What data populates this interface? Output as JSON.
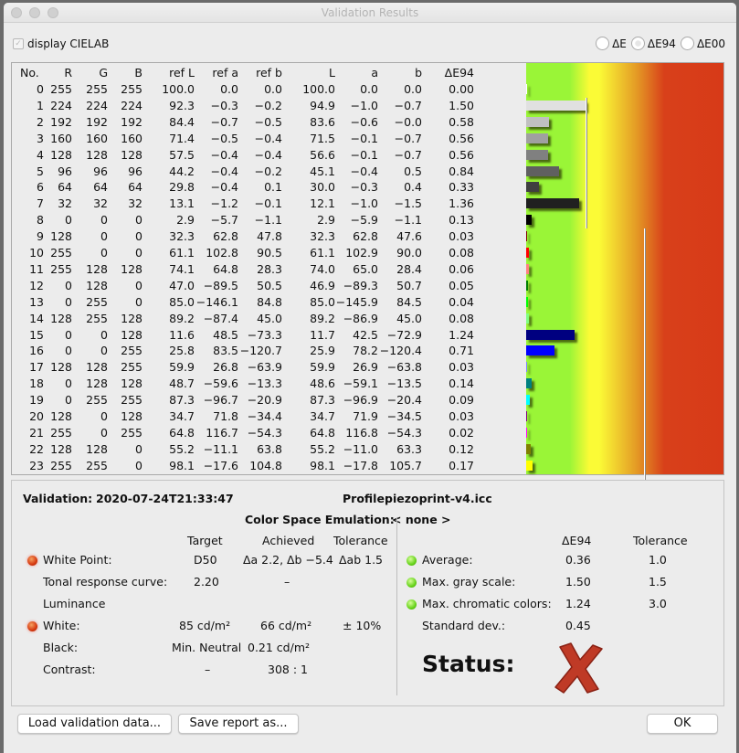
{
  "window": {
    "title": "Validation Results"
  },
  "options": {
    "display_cielab_label": "display CIELAB",
    "display_cielab_checked": true,
    "metrics": [
      {
        "label": "ΔE",
        "selected": false
      },
      {
        "label": "ΔE94",
        "selected": true
      },
      {
        "label": "ΔE00",
        "selected": false
      }
    ]
  },
  "table": {
    "headers": [
      "No.",
      "R",
      "G",
      "B",
      "ref L",
      "ref a",
      "ref b",
      "L",
      "a",
      "b",
      "ΔE94"
    ],
    "rows": [
      [
        "0",
        "255",
        "255",
        "255",
        "100.0",
        "0.0",
        "0.0",
        "100.0",
        "0.0",
        "0.0",
        "0.00"
      ],
      [
        "1",
        "224",
        "224",
        "224",
        "92.3",
        "−0.3",
        "−0.2",
        "94.9",
        "−1.0",
        "−0.7",
        "1.50"
      ],
      [
        "2",
        "192",
        "192",
        "192",
        "84.4",
        "−0.7",
        "−0.5",
        "83.6",
        "−0.6",
        "−0.0",
        "0.58"
      ],
      [
        "3",
        "160",
        "160",
        "160",
        "71.4",
        "−0.5",
        "−0.4",
        "71.5",
        "−0.1",
        "−0.7",
        "0.56"
      ],
      [
        "4",
        "128",
        "128",
        "128",
        "57.5",
        "−0.4",
        "−0.4",
        "56.6",
        "−0.1",
        "−0.7",
        "0.56"
      ],
      [
        "5",
        "96",
        "96",
        "96",
        "44.2",
        "−0.4",
        "−0.2",
        "45.1",
        "−0.4",
        "0.5",
        "0.84"
      ],
      [
        "6",
        "64",
        "64",
        "64",
        "29.8",
        "−0.4",
        "0.1",
        "30.0",
        "−0.3",
        "0.4",
        "0.33"
      ],
      [
        "7",
        "32",
        "32",
        "32",
        "13.1",
        "−1.2",
        "−0.1",
        "12.1",
        "−1.0",
        "−1.5",
        "1.36"
      ],
      [
        "8",
        "0",
        "0",
        "0",
        "2.9",
        "−5.7",
        "−1.1",
        "2.9",
        "−5.9",
        "−1.1",
        "0.13"
      ],
      [
        "9",
        "128",
        "0",
        "0",
        "32.3",
        "62.8",
        "47.8",
        "32.3",
        "62.8",
        "47.6",
        "0.03"
      ],
      [
        "10",
        "255",
        "0",
        "0",
        "61.1",
        "102.8",
        "90.5",
        "61.1",
        "102.9",
        "90.0",
        "0.08"
      ],
      [
        "11",
        "255",
        "128",
        "128",
        "74.1",
        "64.8",
        "28.3",
        "74.0",
        "65.0",
        "28.4",
        "0.06"
      ],
      [
        "12",
        "0",
        "128",
        "0",
        "47.0",
        "−89.5",
        "50.5",
        "46.9",
        "−89.3",
        "50.7",
        "0.05"
      ],
      [
        "13",
        "0",
        "255",
        "0",
        "85.0",
        "−146.1",
        "84.8",
        "85.0",
        "−145.9",
        "84.5",
        "0.04"
      ],
      [
        "14",
        "128",
        "255",
        "128",
        "89.2",
        "−87.4",
        "45.0",
        "89.2",
        "−86.9",
        "45.0",
        "0.08"
      ],
      [
        "15",
        "0",
        "0",
        "128",
        "11.6",
        "48.5",
        "−73.3",
        "11.7",
        "42.5",
        "−72.9",
        "1.24"
      ],
      [
        "16",
        "0",
        "0",
        "255",
        "25.8",
        "83.5",
        "−120.7",
        "25.9",
        "78.2",
        "−120.4",
        "0.71"
      ],
      [
        "17",
        "128",
        "128",
        "255",
        "59.9",
        "26.8",
        "−63.9",
        "59.9",
        "26.9",
        "−63.8",
        "0.03"
      ],
      [
        "18",
        "0",
        "128",
        "128",
        "48.7",
        "−59.6",
        "−13.3",
        "48.6",
        "−59.1",
        "−13.5",
        "0.14"
      ],
      [
        "19",
        "0",
        "255",
        "255",
        "87.3",
        "−96.7",
        "−20.9",
        "87.3",
        "−96.9",
        "−20.4",
        "0.09"
      ],
      [
        "20",
        "128",
        "0",
        "128",
        "34.7",
        "71.8",
        "−34.4",
        "34.7",
        "71.9",
        "−34.5",
        "0.03"
      ],
      [
        "21",
        "255",
        "0",
        "255",
        "64.8",
        "116.7",
        "−54.3",
        "64.8",
        "116.8",
        "−54.3",
        "0.02"
      ],
      [
        "22",
        "128",
        "128",
        "0",
        "55.2",
        "−11.1",
        "63.8",
        "55.2",
        "−11.0",
        "63.3",
        "0.12"
      ],
      [
        "23",
        "255",
        "255",
        "0",
        "98.1",
        "−17.6",
        "104.8",
        "98.1",
        "−17.8",
        "105.7",
        "0.17"
      ]
    ],
    "bar_chart": {
      "gray_tolerance": 1.5,
      "chromatic_tolerance": 3.0,
      "gradient_colors": [
        "#9af537",
        "#fbfb36",
        "#e49a25",
        "#d73a18"
      ]
    }
  },
  "summary": {
    "validation_label": "Validation:",
    "validation_value": "2020-07-24T21:33:47",
    "profile_label": "Profile:",
    "profile_value": "piezoprint-v4.icc",
    "emulation_label": "Color Space Emulation:",
    "emulation_value": "< none >",
    "left_headers": {
      "target": "Target",
      "achieved": "Achieved",
      "tolerance": "Tolerance"
    },
    "white_point": {
      "label": "White Point:",
      "target": "D50",
      "achieved": "Δa 2.2, Δb −5.4",
      "tolerance": "Δab 1.5",
      "status": "fail"
    },
    "trc": {
      "label": "Tonal response curve:",
      "target": "2.20",
      "achieved": "–"
    },
    "luminance_label": "Luminance",
    "white": {
      "label": "White:",
      "target": "85 cd/m²",
      "achieved": "66 cd/m²",
      "tolerance": "± 10%",
      "status": "fail"
    },
    "black": {
      "label": "Black:",
      "target": "Min. Neutral",
      "achieved": "0.21 cd/m²"
    },
    "contrast": {
      "label": "Contrast:",
      "target": "–",
      "achieved": "308 : 1"
    },
    "right_headers": {
      "de": "ΔE94",
      "tolerance": "Tolerance"
    },
    "average": {
      "label": "Average:",
      "value": "0.36",
      "tolerance": "1.0",
      "status": "pass"
    },
    "max_gray": {
      "label": "Max. gray scale:",
      "value": "1.50",
      "tolerance": "1.5",
      "status": "pass"
    },
    "max_chromatic": {
      "label": "Max. chromatic colors:",
      "value": "1.24",
      "tolerance": "3.0",
      "status": "pass"
    },
    "std_dev": {
      "label": "Standard dev.:",
      "value": "0.45"
    },
    "status_label": "Status:",
    "status_value": "fail",
    "colors": {
      "fail": "#c0392b",
      "pass": "#66d21a"
    }
  },
  "buttons": {
    "load": "Load validation data...",
    "save": "Save report as...",
    "ok": "OK"
  }
}
